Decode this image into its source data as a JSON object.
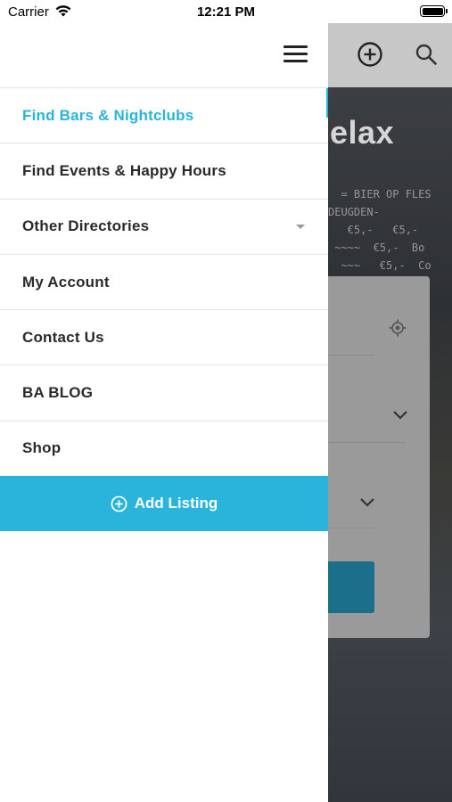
{
  "status_bar": {
    "carrier": "Carrier",
    "time": "12:21 PM"
  },
  "drawer": {
    "menu_icon": "hamburger-menu-icon",
    "items": [
      {
        "label": "Find Bars & Nightclubs",
        "active": true
      },
      {
        "label": "Find Events & Happy Hours",
        "active": false
      },
      {
        "label": "Other Directories",
        "active": false,
        "has_dropdown": true
      },
      {
        "label": "My Account",
        "active": false
      },
      {
        "label": "Contact Us",
        "active": false
      },
      {
        "label": "BA BLOG",
        "active": false
      },
      {
        "label": "Shop",
        "active": false
      }
    ],
    "add_listing": {
      "label": "Add Listing",
      "icon": "plus-circle-icon"
    }
  },
  "background": {
    "hero_text_fragment": "elax",
    "header_icons": [
      "add-circle-icon",
      "search-icon"
    ]
  },
  "colors": {
    "accent": "#29b4db",
    "text": "#2a2a2a",
    "divider": "#e3e3e3"
  }
}
